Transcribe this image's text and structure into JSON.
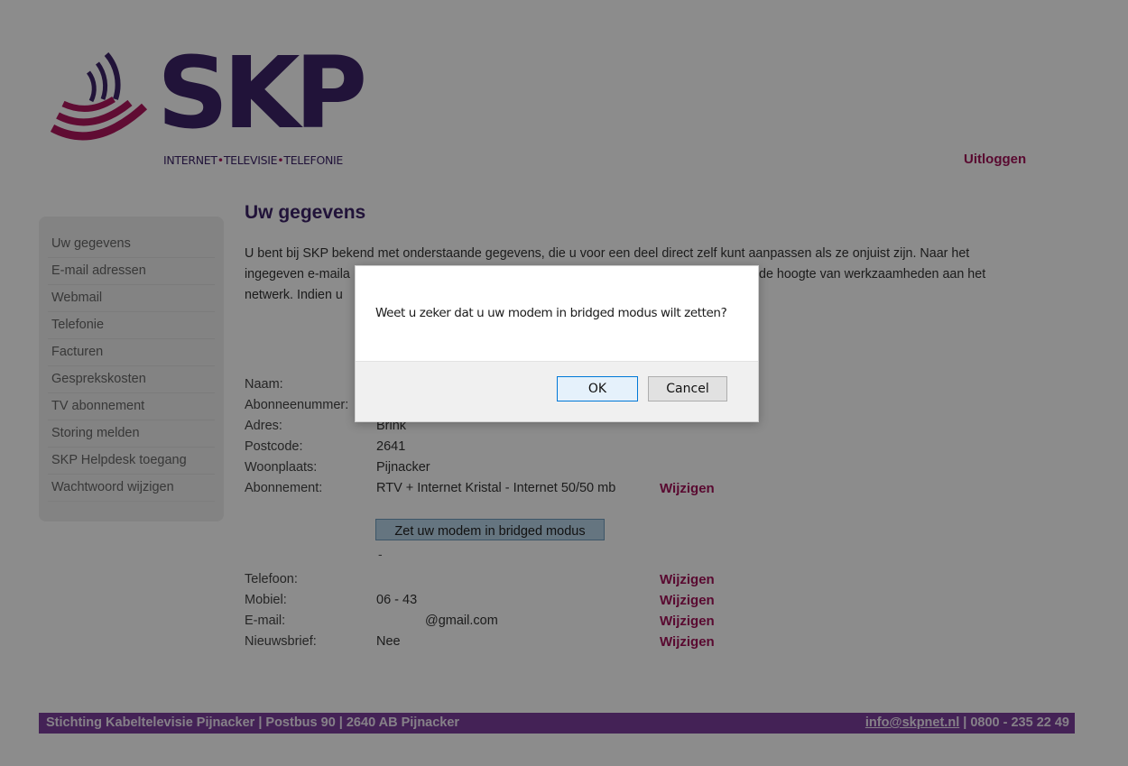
{
  "header": {
    "logo_text": "SKP",
    "tagline": [
      "INTERNET",
      "TELEVISIE",
      "TELEFONIE"
    ],
    "tagline_separator": "•",
    "logout": "Uitloggen"
  },
  "sidebar": {
    "items": [
      {
        "label": "Uw gegevens"
      },
      {
        "label": "E-mail adressen"
      },
      {
        "label": "Webmail"
      },
      {
        "label": "Telefonie"
      },
      {
        "label": "Facturen"
      },
      {
        "label": "Gesprekskosten"
      },
      {
        "label": "TV abonnement"
      },
      {
        "label": "Storing melden"
      },
      {
        "label": "SKP Helpdesk toegang"
      },
      {
        "label": "Wachtwoord wijzigen"
      }
    ]
  },
  "main": {
    "title": "Uw gegevens",
    "intro_line1": "U bent bij SKP bekend met onderstaande gegevens, die u voor een deel direct zelf kunt aanpassen als ze onjuist zijn. Naar het",
    "intro_line2": "ingegeven e-maila",
    "intro_line2_end": "de hoogte van werkzaamheden aan het",
    "intro_line3": "netwerk. Indien u",
    "fields": {
      "naam": {
        "label": "Naam:",
        "value": ""
      },
      "abonneenummer": {
        "label": "Abonneenummer:",
        "value": ""
      },
      "adres": {
        "label": "Adres:",
        "value": "Brink"
      },
      "postcode": {
        "label": "Postcode:",
        "value": "2641"
      },
      "woonplaats": {
        "label": "Woonplaats:",
        "value": "Pijnacker"
      },
      "abonnement": {
        "label": "Abonnement:",
        "value": "RTV + Internet Kristal - Internet 50/50 mb",
        "action": "Wijzigen"
      },
      "telefoon": {
        "label": "Telefoon:",
        "value": "",
        "action": "Wijzigen"
      },
      "mobiel": {
        "label": "Mobiel:",
        "value": "06 - 43",
        "action": "Wijzigen"
      },
      "email": {
        "label": "E-mail:",
        "value": "@gmail.com",
        "action": "Wijzigen"
      },
      "nieuwsbrief": {
        "label": "Nieuwsbrief:",
        "value": "Nee",
        "action": "Wijzigen"
      }
    },
    "bridge_button": "Zet uw modem in bridged modus",
    "dash": "-"
  },
  "footer": {
    "left": "Stichting Kabeltelevisie Pijnacker | Postbus 90 | 2640 AB Pijnacker",
    "email": "info@skpnet.nl",
    "phone": " | 0800 - 235 22 49"
  },
  "dialog": {
    "message": "Weet u zeker dat u uw modem in bridged modus wilt zetten?",
    "ok": "OK",
    "cancel": "Cancel"
  },
  "colors": {
    "brand_purple": "#3d2468",
    "accent_magenta": "#a21258",
    "footer_bg": "#7d3f9d"
  }
}
